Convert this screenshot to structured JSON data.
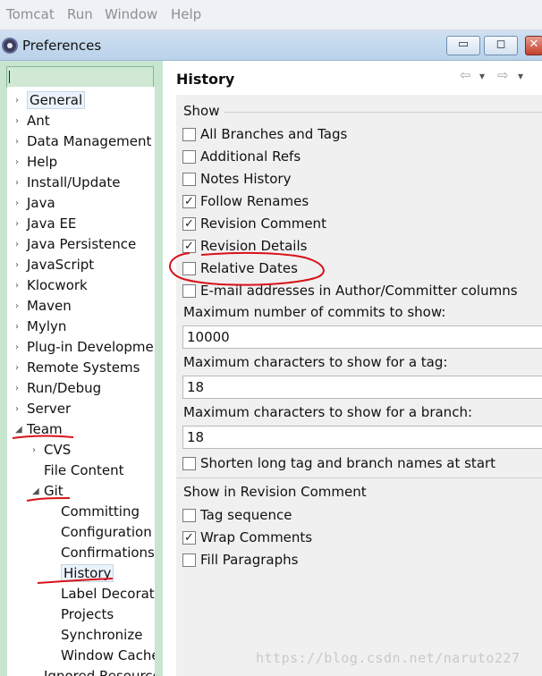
{
  "menubar": [
    "Tomcat",
    "Run",
    "Window",
    "Help"
  ],
  "window": {
    "title": "Preferences",
    "minimize": "▭",
    "maximize": "◻",
    "close": "✕"
  },
  "filter": {
    "value": ""
  },
  "tree": {
    "top": [
      "General",
      "Ant",
      "Data Management",
      "Help",
      "Install/Update",
      "Java",
      "Java EE",
      "Java Persistence",
      "JavaScript",
      "Klocwork",
      "Maven",
      "Mylyn",
      "Plug-in Development",
      "Remote Systems",
      "Run/Debug",
      "Server"
    ],
    "team": "Team",
    "team_children": [
      "CVS",
      "File Content"
    ],
    "git": "Git",
    "git_children": [
      "Committing",
      "Configuration",
      "Confirmations",
      "History",
      "Label Decorations",
      "Projects",
      "Synchronize",
      "Window Cache"
    ],
    "after": "Ignored Resources"
  },
  "page": {
    "title": "History",
    "nav": {
      "back": "⇦",
      "forward": "⇨",
      "dropdown": "▾",
      "menu": "▾"
    },
    "show_section": "Show",
    "show_options": [
      {
        "label": "All Branches and Tags",
        "checked": false
      },
      {
        "label": "Additional Refs",
        "checked": false
      },
      {
        "label": "Notes History",
        "checked": false
      },
      {
        "label": "Follow Renames",
        "checked": true
      },
      {
        "label": "Revision Comment",
        "checked": true
      },
      {
        "label": "Revision Details",
        "checked": true
      },
      {
        "label": "Relative Dates",
        "checked": false
      },
      {
        "label": "E-mail addresses in Author/Committer columns",
        "checked": false
      }
    ],
    "fields": [
      {
        "label": "Maximum number of commits to show:",
        "value": "10000"
      },
      {
        "label": "Maximum characters to show for a tag:",
        "value": "18"
      },
      {
        "label": "Maximum characters to show for a branch:",
        "value": "18"
      }
    ],
    "shorten": {
      "label": "Shorten long tag and branch names at start",
      "checked": false
    },
    "revision_section": "Show in Revision Comment",
    "revision_options": [
      {
        "label": "Tag sequence",
        "checked": false
      },
      {
        "label": "Wrap Comments",
        "checked": true
      },
      {
        "label": "Fill Paragraphs",
        "checked": false
      }
    ]
  },
  "watermark": "https://blog.csdn.net/naruto227",
  "annotation_color": "#d8121a"
}
